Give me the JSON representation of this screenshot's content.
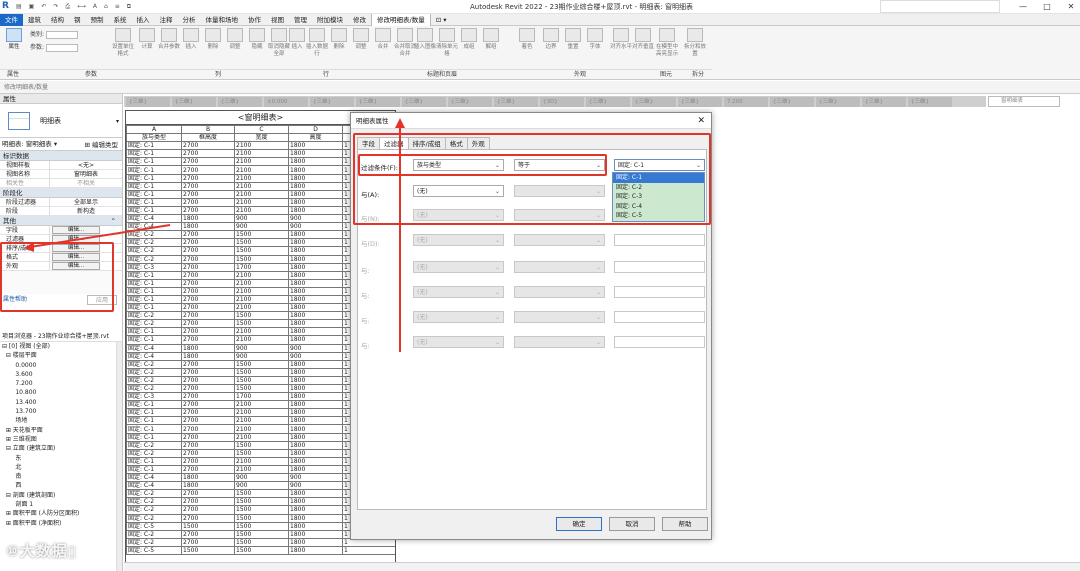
{
  "app": {
    "logo": "R",
    "title": "Autodesk Revit 2022 - 23期作业综合楼+屋顶.rvt - 明细表: 窗明细表",
    "window_buttons": [
      "—",
      "□",
      "✕"
    ]
  },
  "menu": [
    "文件",
    "建筑",
    "结构",
    "钢",
    "预制",
    "系统",
    "插入",
    "注释",
    "分析",
    "体量和场地",
    "协作",
    "视图",
    "管理",
    "附加模块",
    "修改",
    "修改明细表/数量",
    "⊡ ▾"
  ],
  "ribbon": {
    "type_label": "类别:",
    "param_label": "参数:",
    "buttons": [
      "属性",
      "设置单位格式",
      "计算",
      "合并参数",
      "插入",
      "删除",
      "调整",
      "隐藏",
      "取消隐藏全部",
      "插入",
      "插入数据行",
      "删除",
      "调整",
      "合并",
      "合并取消合并",
      "插入图像",
      "清除单元格",
      "成组",
      "解组",
      "着色",
      "边界",
      "重置",
      "字体",
      "对齐水平",
      "对齐垂直",
      "在模型中高亮显示",
      "拆分和放置"
    ],
    "groups": [
      "属性",
      "参数",
      "列",
      "行",
      "标题和页眉",
      "外观",
      "图元",
      "拆分"
    ]
  },
  "options_bar": "修改明细表/数量",
  "properties": {
    "header": "属性",
    "type_name": "明细表",
    "instance": "明细表: 窗明细表",
    "edit_type": "编辑类型",
    "cat_identity": "标识数据",
    "rows_identity": [
      {
        "k": "视图样板",
        "v": "<无>"
      },
      {
        "k": "视图名称",
        "v": "窗明细表"
      },
      {
        "k": "相关性",
        "v": "不相关"
      }
    ],
    "cat_phase": "阶段化",
    "rows_phase": [
      {
        "k": "阶段过滤器",
        "v": "全部显示"
      },
      {
        "k": "阶段",
        "v": "新构造"
      }
    ],
    "cat_other": "其他",
    "rows_other": [
      {
        "k": "字段",
        "v": "编辑..."
      },
      {
        "k": "过滤器",
        "v": "编辑..."
      },
      {
        "k": "排序/成组",
        "v": "编辑..."
      },
      {
        "k": "格式",
        "v": "编辑..."
      },
      {
        "k": "外观",
        "v": "编辑..."
      }
    ],
    "help": "属性帮助",
    "apply": "应用"
  },
  "browser": {
    "header": "项目浏览器 - 23期作业综合楼+屋顶.rvt",
    "items": [
      "⊟ [0] 视图 (全部)",
      "  ⊟ 楼层平面",
      "       0.0000",
      "       3.600",
      "       7.200",
      "       10.800",
      "       13.400",
      "       13.700",
      "       场地",
      "  ⊞ 天花板平面",
      "  ⊞ 三维视图",
      "  ⊟ 立面 (建筑立面)",
      "       东",
      "       北",
      "       南",
      "       西",
      "  ⊟ 剖面 (建筑剖面)",
      "       剖面 1",
      "  ⊞ 面积平面 (人防分区面积)",
      "  ⊞ 面积平面 (净面积)"
    ]
  },
  "view_tabs": [
    "{三维}",
    "{三维}",
    "{三维}",
    "±0.000",
    "{三维}",
    "{三维}",
    "{三维}",
    "{三维}",
    "{三维}",
    "{3D}",
    "{三维}",
    "{三维}",
    "{三维}",
    "7.200",
    "{三维}",
    "{三维}",
    "{三维}",
    "{三维}"
  ],
  "right_search": "窗明细表",
  "schedule": {
    "title": "<窗明细表>",
    "letters": [
      "A",
      "B",
      "C",
      "D",
      "E"
    ],
    "headers": [
      "族与类型",
      "框高度",
      "宽度",
      "高度",
      "合计"
    ],
    "rows": [
      [
        "固定: C-1",
        "2700",
        "2100",
        "1800",
        "1"
      ],
      [
        "固定: C-1",
        "2700",
        "2100",
        "1800",
        "1"
      ],
      [
        "固定: C-1",
        "2700",
        "2100",
        "1800",
        "1"
      ],
      [
        "固定: C-1",
        "2700",
        "2100",
        "1800",
        "1"
      ],
      [
        "固定: C-1",
        "2700",
        "2100",
        "1800",
        "1"
      ],
      [
        "固定: C-1",
        "2700",
        "2100",
        "1800",
        "1"
      ],
      [
        "固定: C-1",
        "2700",
        "2100",
        "1800",
        "1"
      ],
      [
        "固定: C-1",
        "2700",
        "2100",
        "1800",
        "1"
      ],
      [
        "固定: C-1",
        "2700",
        "2100",
        "1800",
        "1"
      ],
      [
        "固定: C-4",
        "1800",
        "900",
        "900",
        "1"
      ],
      [
        "固定: C-4",
        "1800",
        "900",
        "900",
        "1"
      ],
      [
        "固定: C-2",
        "2700",
        "1500",
        "1800",
        "1"
      ],
      [
        "固定: C-2",
        "2700",
        "1500",
        "1800",
        "1"
      ],
      [
        "固定: C-2",
        "2700",
        "1500",
        "1800",
        "1"
      ],
      [
        "固定: C-2",
        "2700",
        "1500",
        "1800",
        "1"
      ],
      [
        "固定: C-3",
        "2700",
        "1700",
        "1800",
        "1"
      ],
      [
        "固定: C-1",
        "2700",
        "2100",
        "1800",
        "1"
      ],
      [
        "固定: C-1",
        "2700",
        "2100",
        "1800",
        "1"
      ],
      [
        "固定: C-1",
        "2700",
        "2100",
        "1800",
        "1"
      ],
      [
        "固定: C-1",
        "2700",
        "2100",
        "1800",
        "1"
      ],
      [
        "固定: C-1",
        "2700",
        "2100",
        "1800",
        "1"
      ],
      [
        "固定: C-2",
        "2700",
        "1500",
        "1800",
        "1"
      ],
      [
        "固定: C-2",
        "2700",
        "1500",
        "1800",
        "1"
      ],
      [
        "固定: C-1",
        "2700",
        "2100",
        "1800",
        "1"
      ],
      [
        "固定: C-1",
        "2700",
        "2100",
        "1800",
        "1"
      ],
      [
        "固定: C-4",
        "1800",
        "900",
        "900",
        "1"
      ],
      [
        "固定: C-4",
        "1800",
        "900",
        "900",
        "1"
      ],
      [
        "固定: C-2",
        "2700",
        "1500",
        "1800",
        "1"
      ],
      [
        "固定: C-2",
        "2700",
        "1500",
        "1800",
        "1"
      ],
      [
        "固定: C-2",
        "2700",
        "1500",
        "1800",
        "1"
      ],
      [
        "固定: C-2",
        "2700",
        "1500",
        "1800",
        "1"
      ],
      [
        "固定: C-3",
        "2700",
        "1700",
        "1800",
        "1"
      ],
      [
        "固定: C-1",
        "2700",
        "2100",
        "1800",
        "1"
      ],
      [
        "固定: C-1",
        "2700",
        "2100",
        "1800",
        "1"
      ],
      [
        "固定: C-1",
        "2700",
        "2100",
        "1800",
        "1"
      ],
      [
        "固定: C-1",
        "2700",
        "2100",
        "1800",
        "1"
      ],
      [
        "固定: C-1",
        "2700",
        "2100",
        "1800",
        "1"
      ],
      [
        "固定: C-2",
        "2700",
        "1500",
        "1800",
        "1"
      ],
      [
        "固定: C-2",
        "2700",
        "1500",
        "1800",
        "1"
      ],
      [
        "固定: C-1",
        "2700",
        "2100",
        "1800",
        "1"
      ],
      [
        "固定: C-1",
        "2700",
        "2100",
        "1800",
        "1"
      ],
      [
        "固定: C-4",
        "1800",
        "900",
        "900",
        "1"
      ],
      [
        "固定: C-4",
        "1800",
        "900",
        "900",
        "1"
      ],
      [
        "固定: C-2",
        "2700",
        "1500",
        "1800",
        "1"
      ],
      [
        "固定: C-2",
        "2700",
        "1500",
        "1800",
        "1"
      ],
      [
        "固定: C-2",
        "2700",
        "1500",
        "1800",
        "1"
      ],
      [
        "固定: C-2",
        "2700",
        "1500",
        "1800",
        "1"
      ],
      [
        "固定: C-5",
        "1500",
        "1500",
        "1800",
        "1"
      ],
      [
        "固定: C-2",
        "2700",
        "1500",
        "1800",
        "1"
      ],
      [
        "固定: C-2",
        "2700",
        "1500",
        "1800",
        "1"
      ],
      [
        "固定: C-5",
        "1500",
        "1500",
        "1800",
        "1"
      ]
    ]
  },
  "dialog": {
    "title": "明细表属性",
    "close": "✕",
    "tabs": [
      "字段",
      "过滤器",
      "排序/成组",
      "格式",
      "外观"
    ],
    "selected_tab": "过滤器",
    "filter_label": "过滤条件(F):",
    "filter_field": "族与类型",
    "filter_op": "等于",
    "filter_value": "固定: C-1",
    "value_options": [
      "固定: C-1",
      "固定: C-2",
      "固定: C-3",
      "固定: C-4",
      "固定: C-5"
    ],
    "and_label_1": "与(A):",
    "and_label_2": "与(N):",
    "and_label_3": "与(D):",
    "and_label_other": "与:",
    "none": "(无)",
    "ok": "确定",
    "cancel": "取消",
    "help": "帮助"
  },
  "watermark": "⑩大数据▯"
}
